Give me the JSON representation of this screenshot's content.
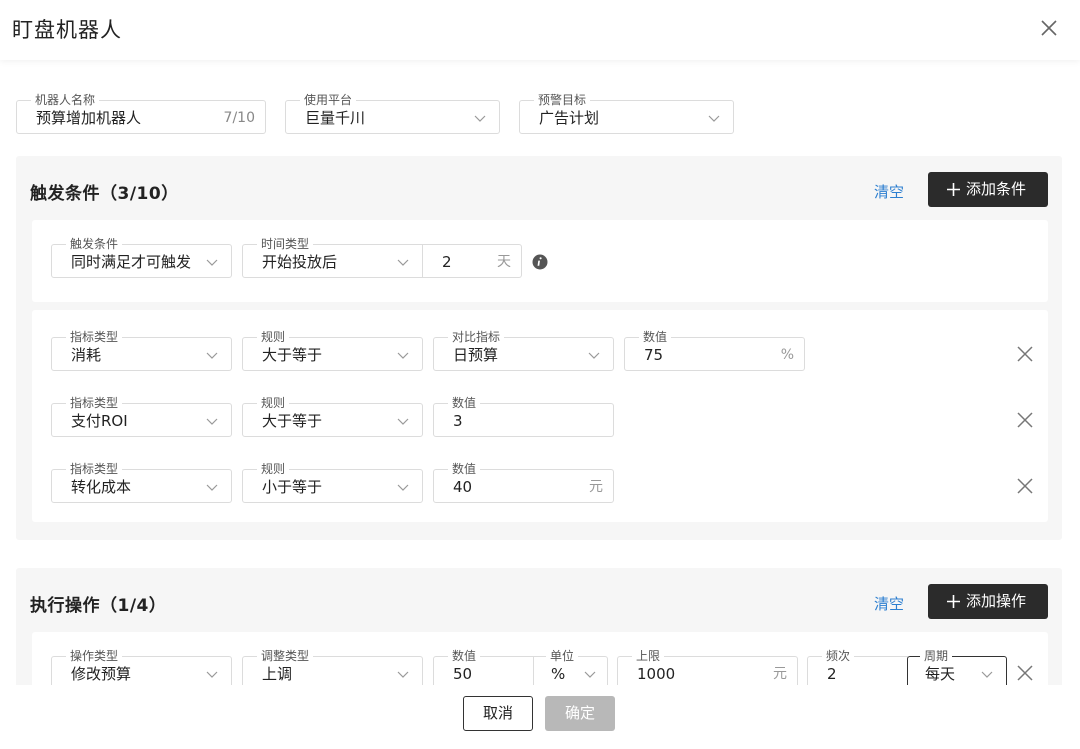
{
  "dialog": {
    "title": "盯盘机器人"
  },
  "basic": {
    "name": {
      "label": "机器人名称",
      "value": "预算增加机器人",
      "counter": "7/10"
    },
    "platform": {
      "label": "使用平台",
      "value": "巨量千川"
    },
    "target": {
      "label": "预警目标",
      "value": "广告计划"
    }
  },
  "trigger": {
    "title": "触发条件（3/10）",
    "clear_label": "清空",
    "add_label": "添加条件",
    "condition": {
      "label": "触发条件",
      "value": "同时满足才可触发"
    },
    "time_type": {
      "label": "时间类型",
      "value": "开始投放后"
    },
    "days": {
      "value": "2",
      "unit": "天"
    },
    "rows": [
      {
        "metric_label": "指标类型",
        "metric": "消耗",
        "rule_label": "规则",
        "rule": "大于等于",
        "compare_label": "对比指标",
        "compare": "日预算",
        "value_label": "数值",
        "value": "75",
        "unit": "%"
      },
      {
        "metric_label": "指标类型",
        "metric": "支付ROI",
        "rule_label": "规则",
        "rule": "大于等于",
        "value_label": "数值",
        "value": "3"
      },
      {
        "metric_label": "指标类型",
        "metric": "转化成本",
        "rule_label": "规则",
        "rule": "小于等于",
        "value_label": "数值",
        "value": "40",
        "unit": "元"
      }
    ]
  },
  "action": {
    "title": "执行操作（1/4）",
    "clear_label": "清空",
    "add_label": "添加操作",
    "row": {
      "op_label": "操作类型",
      "op": "修改预算",
      "adjust_label": "调整类型",
      "adjust": "上调",
      "value_label": "数值",
      "value": "50",
      "unit_label": "单位",
      "unit": "%",
      "limit_label": "上限",
      "limit": "1000",
      "limit_unit": "元",
      "freq_label": "频次",
      "freq": "2",
      "period_label": "周期",
      "period": "每天"
    }
  },
  "footer": {
    "cancel": "取消",
    "confirm": "确定"
  },
  "colors": {
    "link": "#2d7fd0",
    "dark_button": "#2b2b2b",
    "disabled_button": "#b8b8b8",
    "panel_bg": "#f6f6f6"
  },
  "icons": {
    "close": "close-icon",
    "caret": "chevron-down-icon",
    "plus": "plus-icon",
    "info": "info-icon"
  }
}
